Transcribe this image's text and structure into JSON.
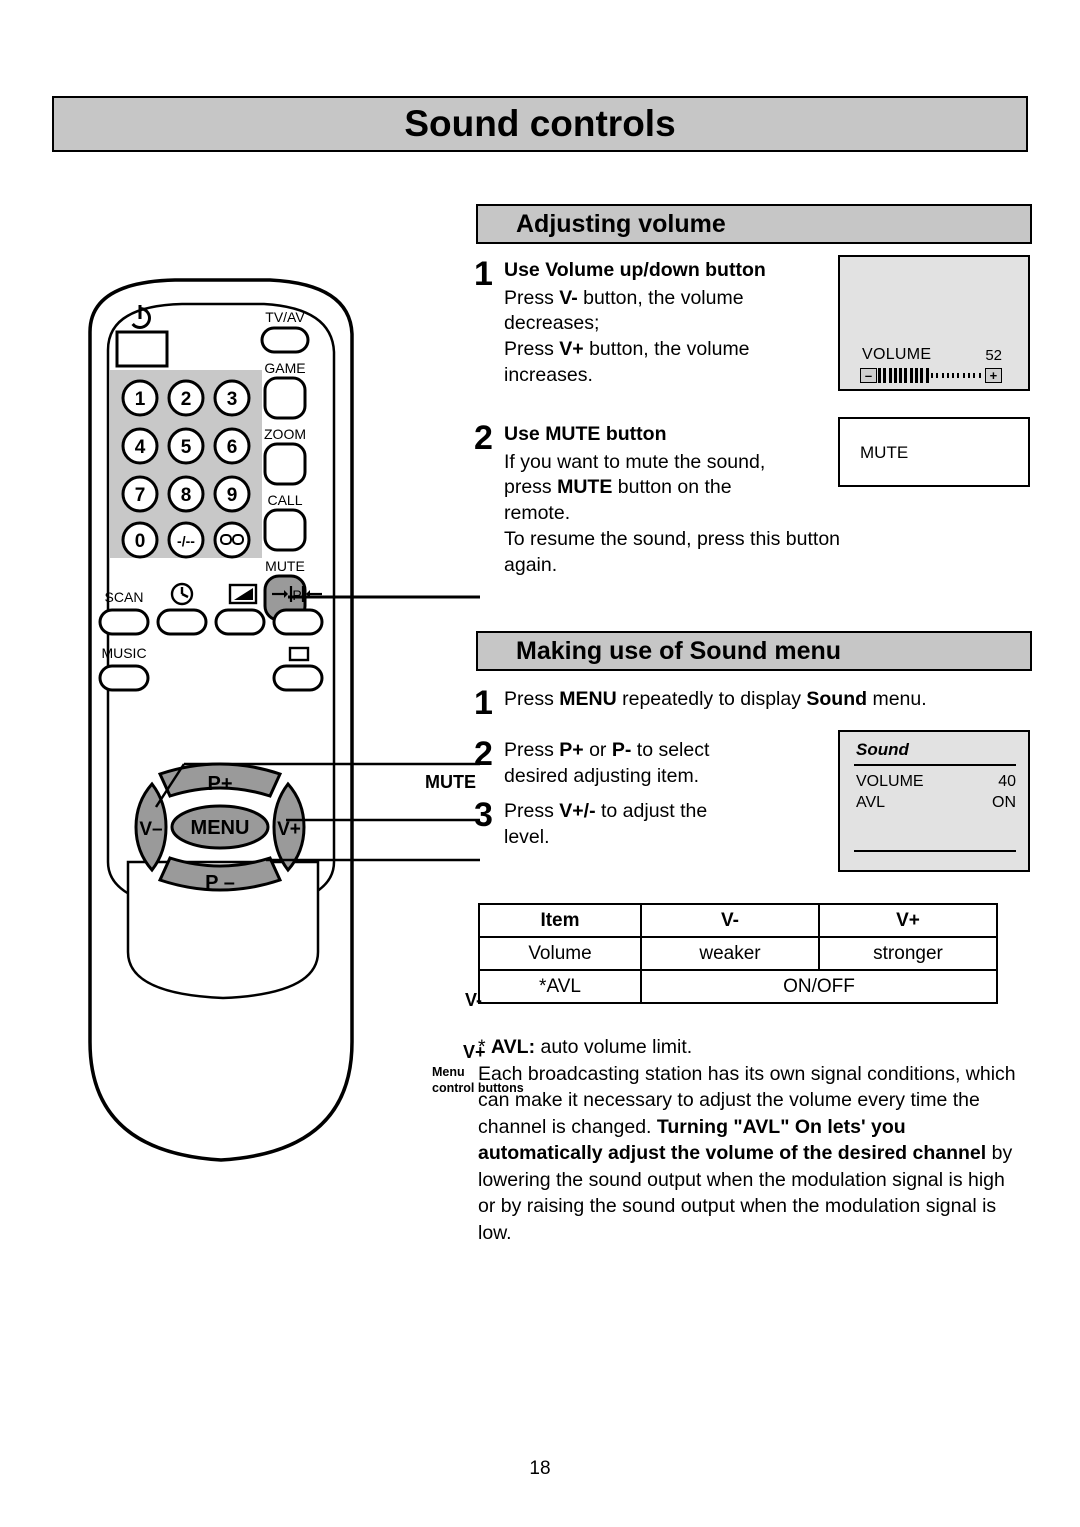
{
  "page": {
    "title": "Sound controls",
    "number": "18"
  },
  "sections": {
    "adjusting_volume": {
      "heading": "Adjusting volume",
      "steps": [
        {
          "num": "1",
          "title": "Use Volume up/down button",
          "lines": [
            "Press V- button, the volume",
            "decreases;",
            "Press V+ button, the volume",
            "increases."
          ]
        },
        {
          "num": "2",
          "title": "Use MUTE button",
          "lines": [
            "If you want to mute the sound,",
            "press MUTE button on the",
            "remote.",
            "To resume the sound, press this button again."
          ]
        }
      ]
    },
    "sound_menu": {
      "heading": "Making use of Sound menu",
      "steps": [
        {
          "num": "1",
          "text": "Press MENU repeatedly to display Sound menu."
        },
        {
          "num": "2",
          "text": "Press P+ or P- to select desired adjusting item."
        },
        {
          "num": "3",
          "text": "Press V+/- to adjust the level."
        }
      ]
    }
  },
  "osd": {
    "volume": {
      "label": "VOLUME",
      "value": "52",
      "minus": "–",
      "plus": "+",
      "filled_ticks": 10,
      "empty_ticks": 10
    },
    "mute": {
      "text": "MUTE"
    },
    "sound": {
      "title": "Sound",
      "rows": [
        {
          "name": "VOLUME",
          "value": "40"
        },
        {
          "name": "AVL",
          "value": "ON"
        }
      ]
    }
  },
  "item_table": {
    "headers": [
      "Item",
      "V-",
      "V+"
    ],
    "rows": [
      {
        "item": "Volume",
        "vminus": "weaker",
        "vplus": "stronger"
      },
      {
        "item": "*AVL",
        "merged": "ON/OFF"
      }
    ]
  },
  "avl_note": {
    "star": "*",
    "term": "AVL:",
    "definition": " auto volume limit.",
    "body_1": "Each broadcasting station has its own signal conditions, which can make it necessary to adjust the volume every time the channel is changed. ",
    "bold_part": "Turning \"AVL\" On  lets' you automatically adjust the volume of the desired channel",
    "body_2": " by lowering the sound output when the modulation signal is high or by raising the sound output when the modulation signal is low."
  },
  "remote": {
    "keypad": [
      "1",
      "2",
      "3",
      "4",
      "5",
      "6",
      "7",
      "8",
      "9",
      "0",
      "-/--",
      "⊟⊟"
    ],
    "side_buttons": [
      "TV/AV",
      "GAME",
      "ZOOM",
      "CALL",
      "MUTE"
    ],
    "function_row_1": [
      "SCAN",
      "clock-icon",
      "contrast-icon",
      "width-icon"
    ],
    "function_row_2": [
      "MUSIC",
      "lock-icon"
    ],
    "menu_cluster": {
      "up": "P+",
      "down": "P –",
      "left": "V–",
      "right": "V+",
      "center": "MENU"
    },
    "callouts": {
      "mute": "MUTE",
      "v_minus": "V-",
      "v_plus": "V+",
      "menu_controls_line1": "Menu",
      "menu_controls_line2": "control buttons"
    }
  },
  "colors": {
    "header_gray": "#c6c6c6",
    "osd_gray": "#e2e2e2",
    "button_gray": "#9a9a9a",
    "keypad_panel_gray": "#c8c8c8"
  }
}
